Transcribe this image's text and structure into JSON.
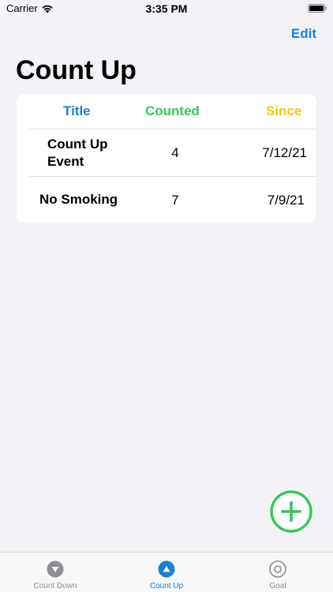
{
  "status_bar": {
    "carrier": "Carrier",
    "time": "3:35 PM"
  },
  "nav": {
    "edit_label": "Edit",
    "title": "Count Up"
  },
  "table": {
    "headers": {
      "title": "Title",
      "counted": "Counted",
      "since": "Since"
    },
    "rows": [
      {
        "title_line1": "Count Up",
        "title_line2": "Event",
        "counted": "4",
        "since": "7/12/21"
      },
      {
        "title_line1": "No Smoking",
        "title_line2": "",
        "counted": "7",
        "since": "7/9/21"
      }
    ]
  },
  "tabs": [
    {
      "label": "Count Down",
      "icon": "chevron-down-circle-icon",
      "active": false
    },
    {
      "label": "Count Up",
      "icon": "triangle-up-circle-icon",
      "active": true
    },
    {
      "label": "Goal",
      "icon": "target-circle-icon",
      "active": false
    }
  ],
  "colors": {
    "accent": "#1a7fd6",
    "green": "#34c759",
    "yellow": "#f5c518",
    "background": "#f2f2f7"
  },
  "add_button": {
    "icon": "plus-circle-icon"
  }
}
